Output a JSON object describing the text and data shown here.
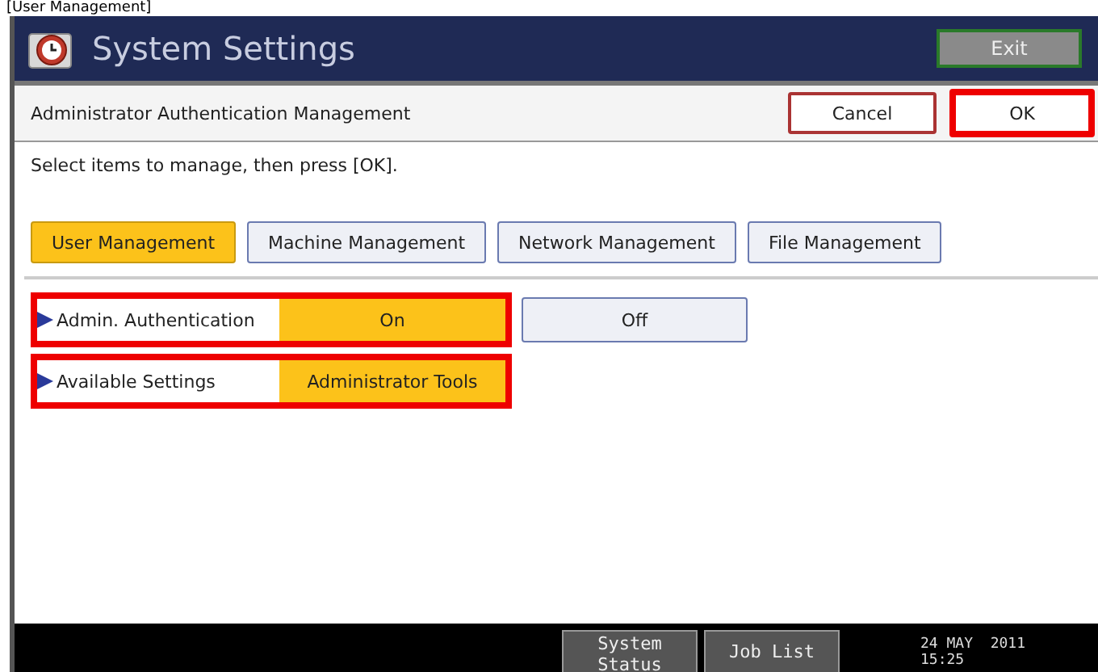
{
  "caption": "[User Management]",
  "window": {
    "title": "System Settings",
    "exit": "Exit"
  },
  "header": {
    "title": "Administrator Authentication Management",
    "buttons": [
      {
        "label": "Cancel",
        "highlighted": false
      },
      {
        "label": "OK",
        "highlighted": true
      }
    ]
  },
  "instruction": "Select items to manage, then press [OK].",
  "tabs": [
    {
      "label": "User Management",
      "selected": true
    },
    {
      "label": "Machine Management",
      "selected": false
    },
    {
      "label": "Network Management",
      "selected": false
    },
    {
      "label": "File Management",
      "selected": false
    }
  ],
  "settings": [
    {
      "label": "Admin. Authentication",
      "highlighted": true,
      "options": [
        {
          "label": "On",
          "selected": true
        },
        {
          "label": "Off",
          "selected": false
        }
      ]
    },
    {
      "label": "Available Settings",
      "highlighted": true,
      "options": [
        {
          "label": "Administrator Tools",
          "selected": true
        }
      ]
    }
  ],
  "status_bar": {
    "buttons": [
      "System Status",
      "Job List"
    ],
    "date": "24 MAY  2011",
    "time": "15:25"
  }
}
